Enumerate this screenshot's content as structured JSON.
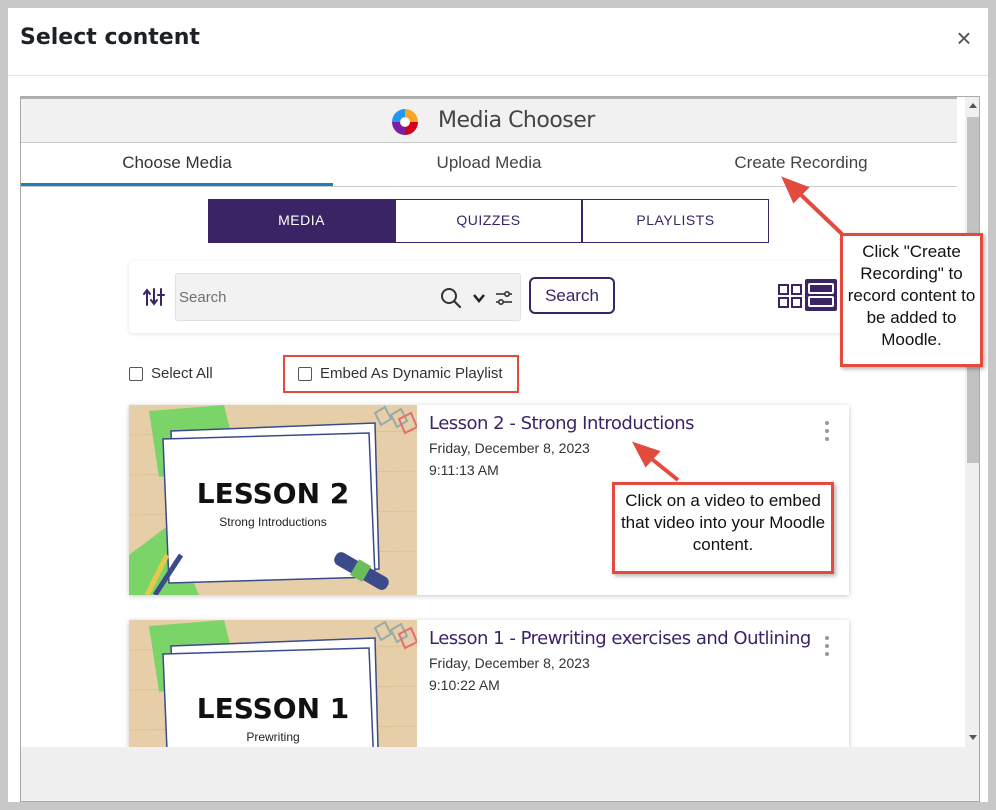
{
  "dialog": {
    "title": "Select content",
    "close_glyph": "×"
  },
  "media_chooser": {
    "title": "Media Chooser",
    "tabs": [
      {
        "label": "Choose Media",
        "active": true
      },
      {
        "label": "Upload Media",
        "active": false
      },
      {
        "label": "Create Recording",
        "active": false
      }
    ],
    "segments": [
      {
        "label": "MEDIA",
        "active": true
      },
      {
        "label": "QUIZZES",
        "active": false
      },
      {
        "label": "PLAYLISTS",
        "active": false
      }
    ],
    "search": {
      "placeholder": "Search",
      "value": "",
      "button_label": "Search"
    },
    "select_all_label": "Select All",
    "embed_playlist_label": "Embed As Dynamic Playlist",
    "items": [
      {
        "title": "Lesson 2 - Strong Introductions",
        "date": "Friday, December 8, 2023",
        "time": "9:11:13 AM",
        "thumb_heading": "LESSON 2",
        "thumb_sub": "Strong Introductions"
      },
      {
        "title": "Lesson 1 - Prewriting exercises and Outlining",
        "date": "Friday, December 8, 2023",
        "time": "9:10:22 AM",
        "thumb_heading": "LESSON 1",
        "thumb_sub": "Prewriting"
      }
    ]
  },
  "annotations": {
    "create_recording": "Click \"Create Recording\" to record content to be added to Moodle.",
    "click_video": "Click on a video to embed that video into your Moodle content."
  },
  "colors": {
    "brand_purple": "#3b2466",
    "callout_red": "#e24b3e",
    "tab_underline": "#1b7fb9"
  },
  "icons": [
    "close-icon",
    "media-chooser-logo",
    "sort-icon",
    "search-icon",
    "chevron-down-icon",
    "filter-icon",
    "grid-view-icon",
    "list-view-icon",
    "kebab-menu-icon"
  ]
}
